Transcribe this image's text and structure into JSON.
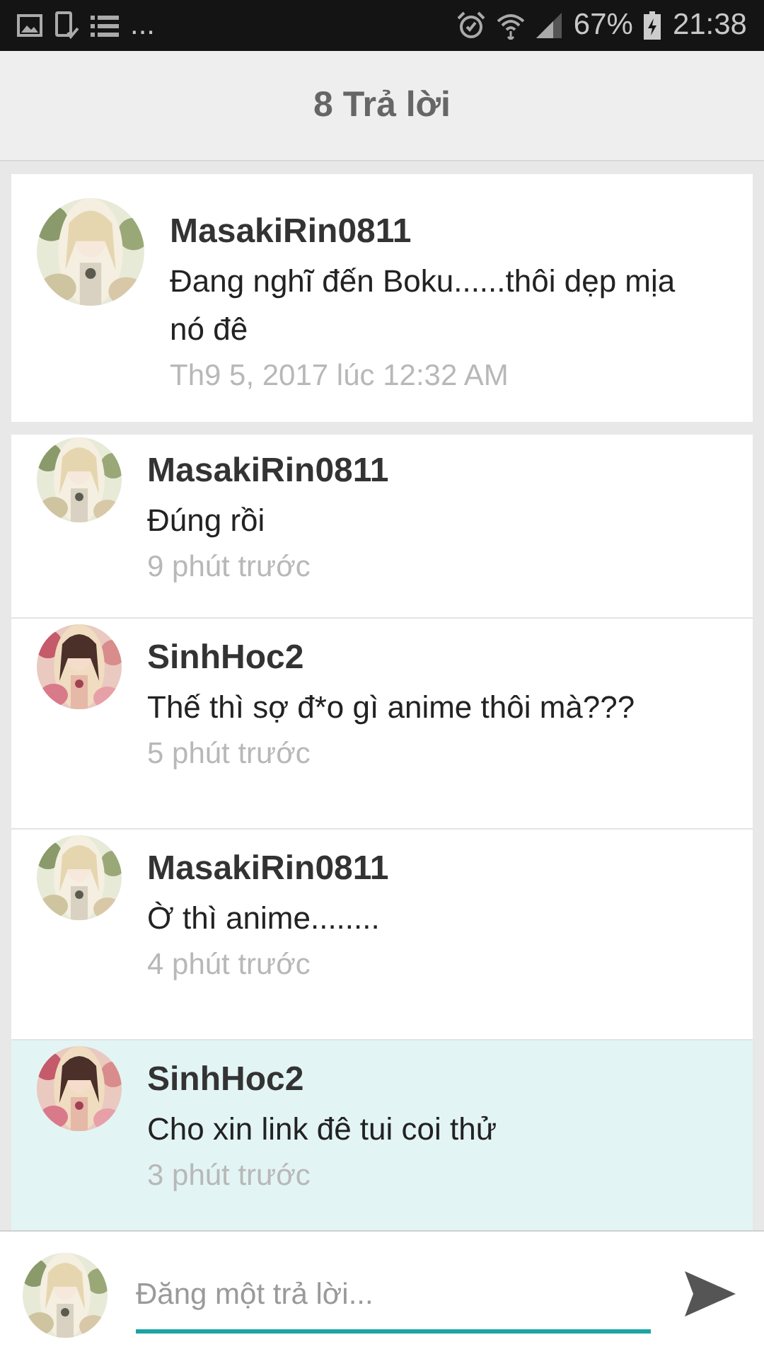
{
  "status_bar": {
    "overflow": "...",
    "battery": "67%",
    "time": "21:38"
  },
  "header": {
    "title": "8 Trả lời"
  },
  "post": {
    "author": "MasakiRin0811",
    "text": "Đang nghĩ đến Boku......thôi dẹp mịa nó đê",
    "time": "Th9 5, 2017 lúc 12:32 AM"
  },
  "replies": [
    {
      "author": "MasakiRin0811",
      "text": "Đúng rồi",
      "time": "9 phút trước",
      "highlighted": false
    },
    {
      "author": "SinhHoc2",
      "text": "Thế thì sợ đ*o gì anime thôi mà???",
      "time": "5 phút trước",
      "highlighted": false
    },
    {
      "author": "MasakiRin0811",
      "text": "Ờ thì anime........",
      "time": "4 phút trước",
      "highlighted": false
    },
    {
      "author": "SinhHoc2",
      "text": "Cho xin link đê tui coi thử",
      "time": "3 phút trước",
      "highlighted": true
    }
  ],
  "composer": {
    "placeholder": "Đăng một trả lời..."
  }
}
